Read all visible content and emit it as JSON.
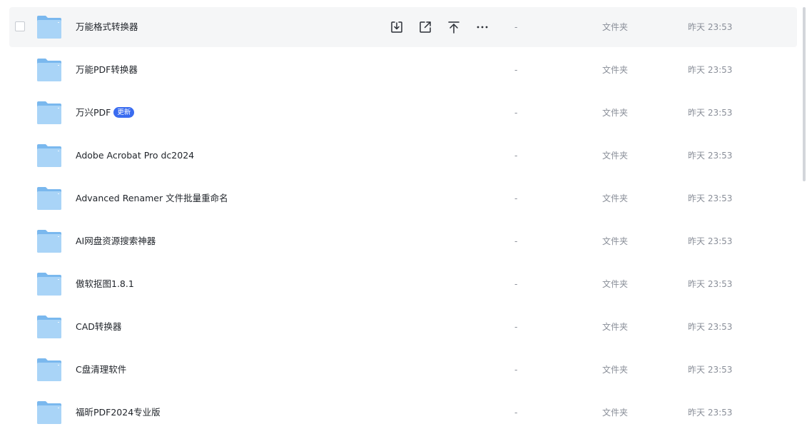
{
  "rows": [
    {
      "name": "万能格式转换器",
      "size": "-",
      "type": "文件夹",
      "time": "昨天 23:53",
      "badge": ""
    },
    {
      "name": "万能PDF转换器",
      "size": "-",
      "type": "文件夹",
      "time": "昨天 23:53",
      "badge": ""
    },
    {
      "name": "万兴PDF",
      "size": "-",
      "type": "文件夹",
      "time": "昨天 23:53",
      "badge": "更新"
    },
    {
      "name": "Adobe Acrobat Pro dc2024",
      "size": "-",
      "type": "文件夹",
      "time": "昨天 23:53",
      "badge": ""
    },
    {
      "name": "Advanced Renamer 文件批量重命名",
      "size": "-",
      "type": "文件夹",
      "time": "昨天 23:53",
      "badge": ""
    },
    {
      "name": "AI网盘资源搜索神器",
      "size": "-",
      "type": "文件夹",
      "time": "昨天 23:53",
      "badge": ""
    },
    {
      "name": "傲软抠图1.8.1",
      "size": "-",
      "type": "文件夹",
      "time": "昨天 23:53",
      "badge": ""
    },
    {
      "name": "CAD转换器",
      "size": "-",
      "type": "文件夹",
      "time": "昨天 23:53",
      "badge": ""
    },
    {
      "name": "C盘清理软件",
      "size": "-",
      "type": "文件夹",
      "time": "昨天 23:53",
      "badge": ""
    },
    {
      "name": "福昕PDF2024专业版",
      "size": "-",
      "type": "文件夹",
      "time": "昨天 23:53",
      "badge": ""
    }
  ],
  "row_actions": [
    {
      "icon": "download-icon"
    },
    {
      "icon": "share-icon"
    },
    {
      "icon": "move-to-top-icon"
    },
    {
      "icon": "more-icon"
    }
  ],
  "colors": {
    "folder_light": "#a9d4f7",
    "folder_dark": "#7ab8ee",
    "badge": "#3a6cf0",
    "hover_bg": "#f5f6f7",
    "muted_text": "#8a8f99"
  }
}
